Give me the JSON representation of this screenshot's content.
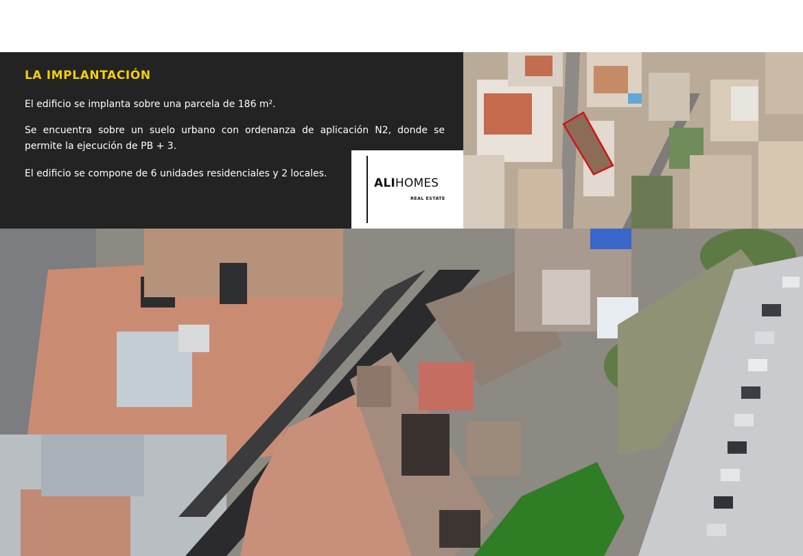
{
  "section": {
    "title": "LA IMPLANTACIÓN",
    "paragraphs": [
      "El edificio se implanta sobre una parcela de 186 m².",
      "Se encuentra sobre un suelo urbano con ordenanza de aplicación N2, donde se permite la ejecución de PB + 3.",
      "El edificio se compone de 6 unidades residenciales y 2 locales."
    ]
  },
  "logo": {
    "brand_bold": "ALI",
    "brand_light": "HOMES",
    "tagline": "REAL ESTATE"
  },
  "colors": {
    "panel_background": "#232323",
    "title_accent": "#f5d000",
    "parcel_outline": "#d0141a"
  }
}
